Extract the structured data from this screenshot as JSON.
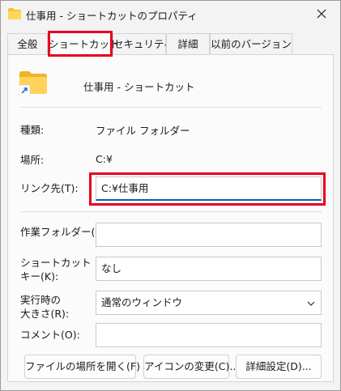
{
  "window": {
    "title": "仕事用 - ショートカットのプロパティ"
  },
  "tabs": [
    {
      "label": "全般"
    },
    {
      "label": "ショートカット",
      "active": true
    },
    {
      "label": "セキュリティ"
    },
    {
      "label": "詳細"
    },
    {
      "label": "以前のバージョン"
    }
  ],
  "header": {
    "shortcut_name": "仕事用 - ショートカット"
  },
  "info": {
    "type_label": "種類:",
    "type_value": "ファイル フォルダー",
    "location_label": "場所:",
    "location_value": "C:¥"
  },
  "fields": {
    "target_label": "リンク先(T):",
    "target_value": "C:¥仕事用",
    "start_in_label": "作業フォルダー(S):",
    "start_in_value": "",
    "shortcut_key_label_1": "ショートカット",
    "shortcut_key_label_2": "キー(K):",
    "shortcut_key_value": "なし",
    "run_label_1": "実行時の",
    "run_label_2": "大きさ(R):",
    "run_value": "通常のウィンドウ",
    "comment_label": "コメント(O):",
    "comment_value": ""
  },
  "buttons": {
    "open_location": "ファイルの場所を開く(F)",
    "change_icon": "アイコンの変更(C)...",
    "advanced": "詳細設定(D)..."
  },
  "icons": {
    "title_folder": "folder-icon",
    "close": "close-icon",
    "big_folder": "folder-shortcut-icon",
    "chevron": "chevron-down-icon"
  },
  "colors": {
    "highlight": "#e8001f",
    "folder": "#f8c33a",
    "shortcut_arrow": "#1f6fd0",
    "focus_underline": "#005fb8"
  }
}
